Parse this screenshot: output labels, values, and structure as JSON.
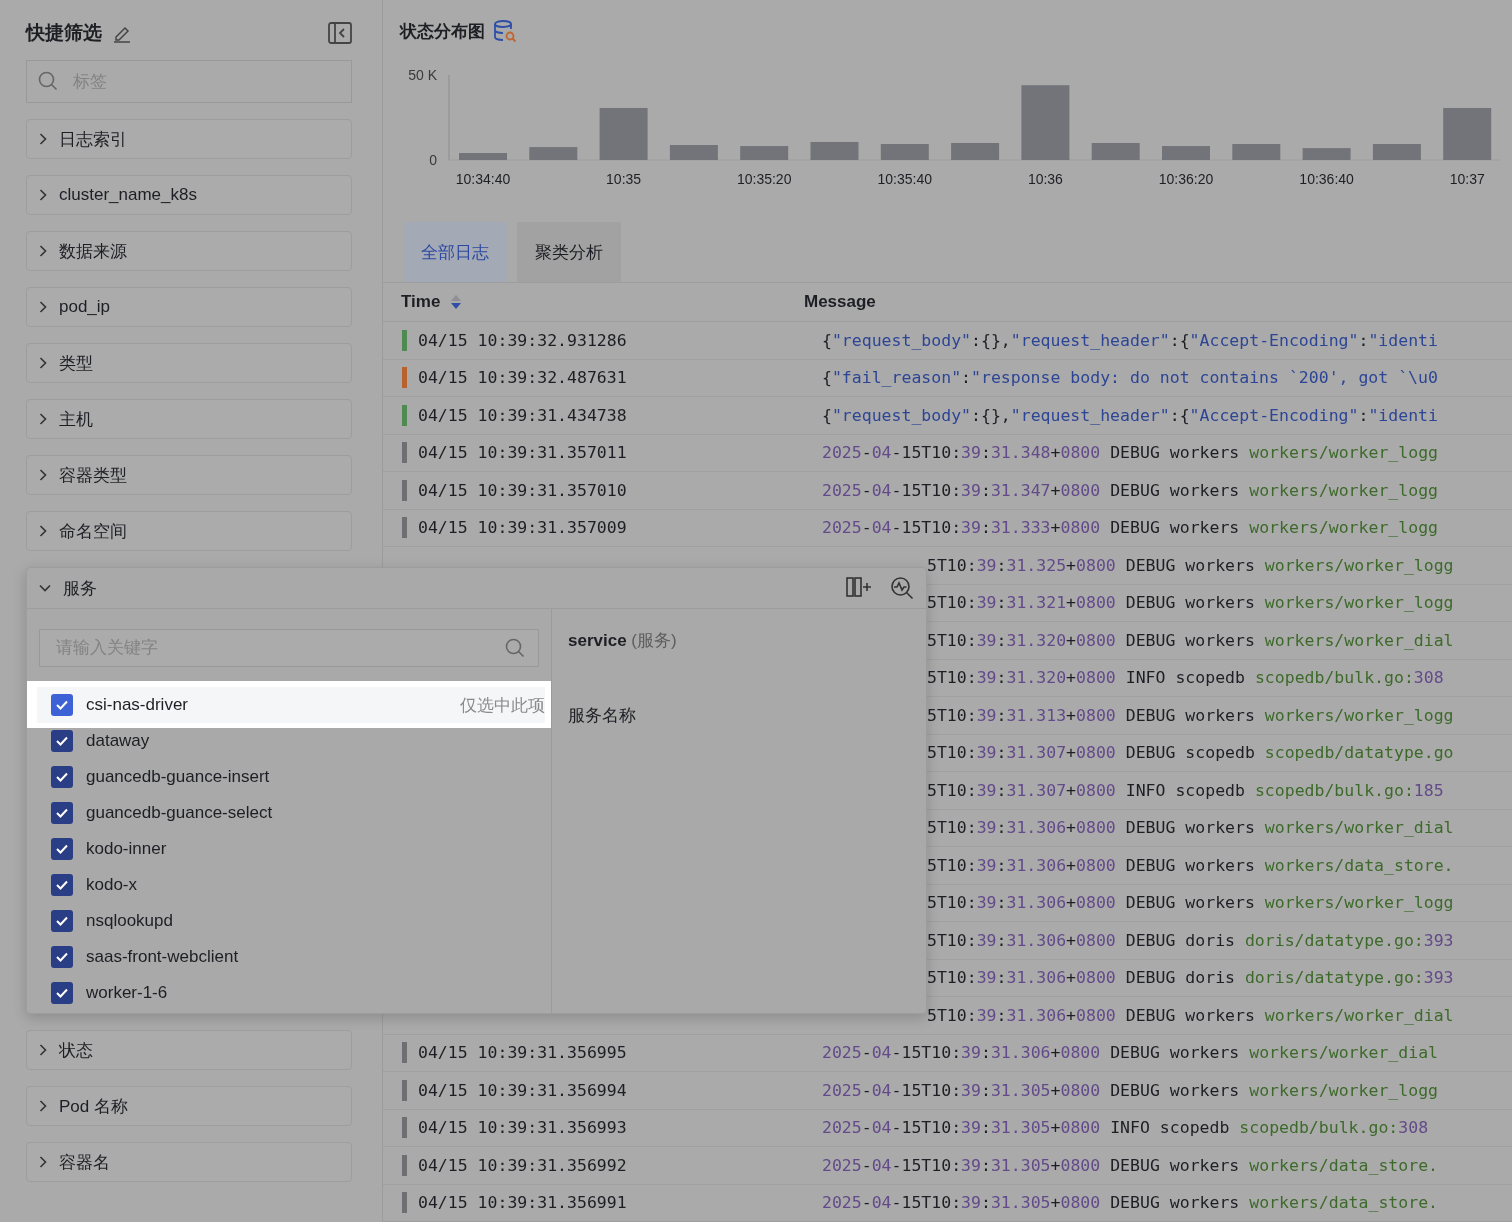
{
  "sidebar": {
    "title": "快捷筛选",
    "search": {
      "placeholder": "标签"
    },
    "facets": [
      {
        "label": "日志索引",
        "expanded": false
      },
      {
        "label": "cluster_name_k8s",
        "expanded": false
      },
      {
        "label": "数据来源",
        "expanded": false
      },
      {
        "label": "pod_ip",
        "expanded": false
      },
      {
        "label": "类型",
        "expanded": false
      },
      {
        "label": "主机",
        "expanded": false
      },
      {
        "label": "容器类型",
        "expanded": false
      },
      {
        "label": "命名空间",
        "expanded": false
      },
      {
        "label": "服务",
        "expanded": true,
        "panel": {
          "search": {
            "placeholder": "请输入关键字"
          },
          "field_name": "service",
          "field_alias": "(服务)",
          "description": "服务名称",
          "options": [
            {
              "label": "csi-nas-driver",
              "checked": true,
              "highlighted": true,
              "action": "仅选中此项"
            },
            {
              "label": "dataway",
              "checked": true,
              "highlighted": false
            },
            {
              "label": "guancedb-guance-insert",
              "checked": true,
              "highlighted": false
            },
            {
              "label": "guancedb-guance-select",
              "checked": true,
              "highlighted": false
            },
            {
              "label": "kodo-inner",
              "checked": true,
              "highlighted": false
            },
            {
              "label": "kodo-x",
              "checked": true,
              "highlighted": false
            },
            {
              "label": "nsqlookupd",
              "checked": true,
              "highlighted": false
            },
            {
              "label": "saas-front-webclient",
              "checked": true,
              "highlighted": false
            },
            {
              "label": "worker-1-6",
              "checked": true,
              "highlighted": false
            }
          ]
        }
      },
      {
        "label": "状态",
        "expanded": false
      },
      {
        "label": "Pod 名称",
        "expanded": false
      },
      {
        "label": "容器名",
        "expanded": false
      }
    ]
  },
  "chart": {
    "title": "状态分布图",
    "chart_data": {
      "type": "bar",
      "categories": [
        "10:34:40",
        null,
        "10:35",
        null,
        "10:35:20",
        null,
        "10:35:40",
        null,
        "10:36",
        null,
        "10:36:20",
        null,
        "10:36:40",
        null,
        "10:37"
      ],
      "series": [
        {
          "color": "#737479",
          "values": [
            4100,
            7600,
            30600,
            8800,
            8200,
            10600,
            9400,
            10000,
            44000,
            10000,
            8200,
            9400,
            7000,
            9400,
            30600
          ]
        }
      ],
      "ylim": [
        0,
        50000
      ],
      "yticks": [
        0,
        {
          "value": 50000,
          "label": "50 K"
        }
      ]
    }
  },
  "tabs": [
    {
      "label": "全部日志",
      "selected": true
    },
    {
      "label": "聚类分析",
      "selected": false
    }
  ],
  "table": {
    "columns": [
      "Time",
      "Message"
    ],
    "rows": [
      {
        "time": "04/15 10:39:32.931286",
        "color": "#4e8a52",
        "message": "{\"request_body\":{},\"request_header\":{\"Accept-Encoding\":\"identi"
      },
      {
        "time": "04/15 10:39:32.487631",
        "color": "#b8632e",
        "message": "{\"fail_reason\":\"response body: do not contains `200', got `\\u0"
      },
      {
        "time": "04/15 10:39:31.434738",
        "color": "#4e8a52",
        "message": "{\"request_body\":{},\"request_header\":{\"Accept-Encoding\":\"identi"
      },
      {
        "time": "04/15 10:39:31.357011",
        "color": "#6f6f73",
        "message": "2025-04-15T10:39:31.348+0800 DEBUG workers workers/worker_logg"
      },
      {
        "time": "04/15 10:39:31.357010",
        "color": "#6f6f73",
        "message": "2025-04-15T10:39:31.347+0800 DEBUG workers workers/worker_logg"
      },
      {
        "time": "04/15 10:39:31.357009",
        "color": "#6f6f73",
        "message": "2025-04-15T10:39:31.333+0800 DEBUG workers workers/worker_logg"
      },
      {
        "message": "5T10:39:31.325+0800 DEBUG workers workers/worker_logg"
      },
      {
        "message": "5T10:39:31.321+0800 DEBUG workers workers/worker_logg"
      },
      {
        "message": "5T10:39:31.320+0800 DEBUG workers workers/worker_dial"
      },
      {
        "message": "5T10:39:31.320+0800 INFO scopedb scopedb/bulk.go:308"
      },
      {
        "message": "5T10:39:31.313+0800 DEBUG workers workers/worker_logg"
      },
      {
        "message": "5T10:39:31.307+0800 DEBUG scopedb scopedb/datatype.go"
      },
      {
        "message": "5T10:39:31.307+0800 INFO scopedb scopedb/bulk.go:185"
      },
      {
        "message": "5T10:39:31.306+0800 DEBUG workers workers/worker_dial"
      },
      {
        "message": "5T10:39:31.306+0800 DEBUG workers workers/data_store."
      },
      {
        "message": "5T10:39:31.306+0800 DEBUG workers workers/worker_logg"
      },
      {
        "message": "5T10:39:31.306+0800 DEBUG doris doris/datatype.go:393"
      },
      {
        "message": "5T10:39:31.306+0800 DEBUG doris doris/datatype.go:393"
      },
      {
        "message": "5T10:39:31.306+0800 DEBUG workers workers/worker_dial"
      },
      {
        "time": "04/15 10:39:31.356995",
        "color": "#6f6f73",
        "message": "2025-04-15T10:39:31.306+0800 DEBUG workers workers/worker_dial"
      },
      {
        "time": "04/15 10:39:31.356994",
        "color": "#6f6f73",
        "message": "2025-04-15T10:39:31.305+0800 DEBUG workers workers/worker_logg"
      },
      {
        "time": "04/15 10:39:31.356993",
        "color": "#6f6f73",
        "message": "2025-04-15T10:39:31.305+0800 INFO scopedb scopedb/bulk.go:308"
      },
      {
        "time": "04/15 10:39:31.356992",
        "color": "#6f6f73",
        "message": "2025-04-15T10:39:31.305+0800 DEBUG workers workers/data_store."
      },
      {
        "time": "04/15 10:39:31.356991",
        "color": "#6f6f73",
        "message": "2025-04-15T10:39:31.305+0800 DEBUG workers workers/data_store."
      }
    ]
  }
}
